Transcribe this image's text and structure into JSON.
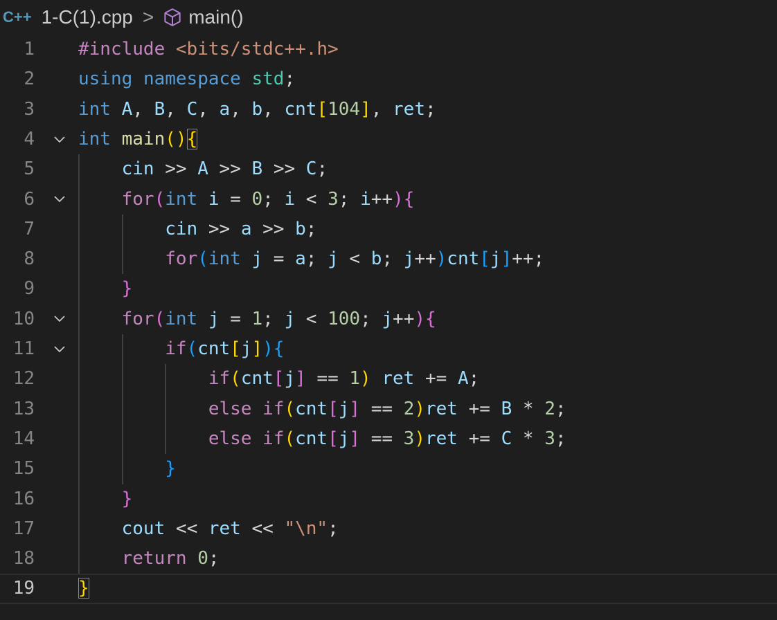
{
  "breadcrumb": {
    "file_icon": "C++",
    "file_name": "1-C(1).cpp",
    "separator": ">",
    "symbol_name": "main()"
  },
  "editor": {
    "language": "cpp",
    "active_line": 19,
    "lines": [
      {
        "n": "1",
        "text": "#include <bits/stdc++.h>"
      },
      {
        "n": "2",
        "text": "using namespace std;"
      },
      {
        "n": "3",
        "text": "int A, B, C, a, b, cnt[104], ret;"
      },
      {
        "n": "4",
        "text": "int main(){"
      },
      {
        "n": "5",
        "text": "    cin >> A >> B >> C;"
      },
      {
        "n": "6",
        "text": "    for(int i = 0; i < 3; i++){"
      },
      {
        "n": "7",
        "text": "        cin >> a >> b;"
      },
      {
        "n": "8",
        "text": "        for(int j = a; j < b; j++)cnt[j]++;"
      },
      {
        "n": "9",
        "text": "    }"
      },
      {
        "n": "10",
        "text": "    for(int j = 1; j < 100; j++){"
      },
      {
        "n": "11",
        "text": "        if(cnt[j]){"
      },
      {
        "n": "12",
        "text": "            if(cnt[j] == 1) ret += A;"
      },
      {
        "n": "13",
        "text": "            else if(cnt[j] == 2)ret += B * 2;"
      },
      {
        "n": "14",
        "text": "            else if(cnt[j] == 3)ret += C * 3;"
      },
      {
        "n": "15",
        "text": "        }"
      },
      {
        "n": "16",
        "text": "    }"
      },
      {
        "n": "17",
        "text": "    cout << ret << \"\\n\";"
      },
      {
        "n": "18",
        "text": "    return 0;"
      },
      {
        "n": "19",
        "text": "}"
      }
    ],
    "foldable_lines": [
      4,
      6,
      10,
      11
    ]
  },
  "colors": {
    "background": "#1e1e1e",
    "line_number": "#858585",
    "keyword": "#569cd6",
    "control": "#c586c0",
    "string": "#ce9178",
    "number": "#b5cea8",
    "function": "#dcdcaa",
    "variable": "#9cdcfe",
    "bracket_level1": "#ffd700",
    "bracket_level2": "#da70d6",
    "bracket_level3": "#179fff"
  }
}
